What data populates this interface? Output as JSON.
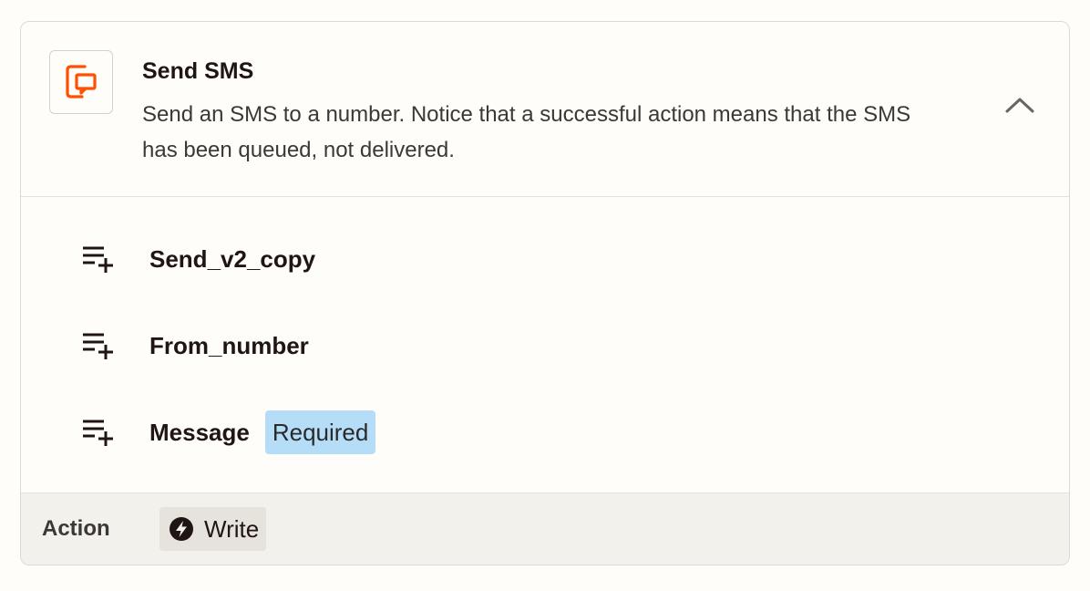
{
  "card": {
    "title": "Send SMS",
    "description": "Send an SMS to a number. Notice that a successful action means that the SMS has been queued, not delivered.",
    "app_icon": "sms-device-icon",
    "collapse_icon": "chevron-up-icon"
  },
  "fields": [
    {
      "label": "Send_v2_copy",
      "icon": "list-add-icon"
    },
    {
      "label": "From_number",
      "icon": "list-add-icon"
    },
    {
      "label": "Message",
      "icon": "list-add-icon",
      "badge": "Required"
    }
  ],
  "footer": {
    "label": "Action",
    "badge_label": "Write",
    "badge_icon": "lightning-bolt-icon"
  },
  "colors": {
    "accent": "#ff4f00",
    "required_badge_bg": "#b6ddf7",
    "footer_bg": "#f3f1ec"
  }
}
